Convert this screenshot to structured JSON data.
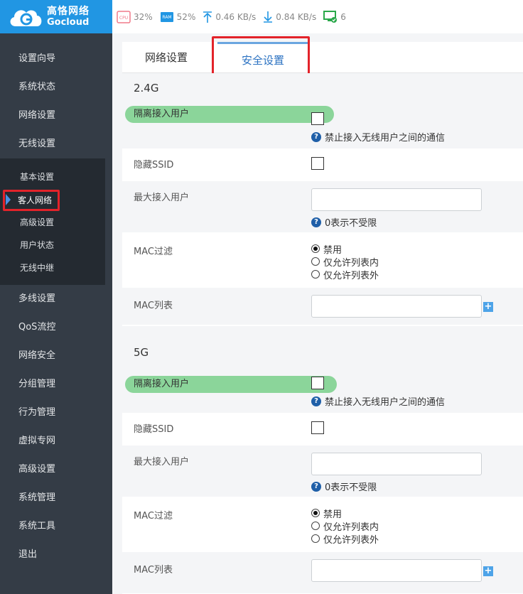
{
  "brand": {
    "name_cn": "高恪网络",
    "name_en": "Gocloud"
  },
  "status": {
    "cpu_label": "CPU",
    "cpu_value": "32%",
    "ram_label": "RAM",
    "ram_value": "52%",
    "upload": "0.46 KB/s",
    "download": "0.84 KB/s",
    "devices": "6"
  },
  "sidebar": {
    "items_top": [
      "设置向导",
      "系统状态",
      "网络设置",
      "无线设置"
    ],
    "submenu": [
      "基本设置",
      "客人网络",
      "高级设置",
      "用户状态",
      "无线中继"
    ],
    "items_bottom": [
      "多线设置",
      "QoS流控",
      "网络安全",
      "分组管理",
      "行为管理",
      "虚拟专网",
      "高级设置",
      "系统管理",
      "系统工具",
      "退出"
    ]
  },
  "tabs": [
    "网络设置",
    "安全设置"
  ],
  "sections": [
    {
      "title": "2.4G",
      "isolate_label": "隔离接入用户",
      "isolate_hint": "禁止接入无线用户之间的通信",
      "hide_ssid_label": "隐藏SSID",
      "max_users_label": "最大接入用户",
      "max_users_value": "",
      "max_users_hint": "0表示不受限",
      "mac_filter_label": "MAC过滤",
      "mac_filter_options": [
        "禁用",
        "仅允许列表内",
        "仅允许列表外"
      ],
      "mac_list_label": "MAC列表",
      "mac_list_value": ""
    },
    {
      "title": "5G",
      "isolate_label": "隔离接入用户",
      "isolate_hint": "禁止接入无线用户之间的通信",
      "hide_ssid_label": "隐藏SSID",
      "max_users_label": "最大接入用户",
      "max_users_value": "",
      "max_users_hint": "0表示不受限",
      "mac_filter_label": "MAC过滤",
      "mac_filter_options": [
        "禁用",
        "仅允许列表内",
        "仅允许列表外"
      ],
      "mac_list_label": "MAC列表",
      "mac_list_value": ""
    }
  ],
  "icons": {
    "help": "help-icon",
    "add": "plus-icon",
    "upload": "arrow-up-icon",
    "download": "arrow-down-icon",
    "devices": "monitor-check-icon"
  },
  "colors": {
    "brand": "#2196e3",
    "sidebar": "#343c46",
    "highlight": "#e3232a",
    "pill": "#8bd59a"
  }
}
